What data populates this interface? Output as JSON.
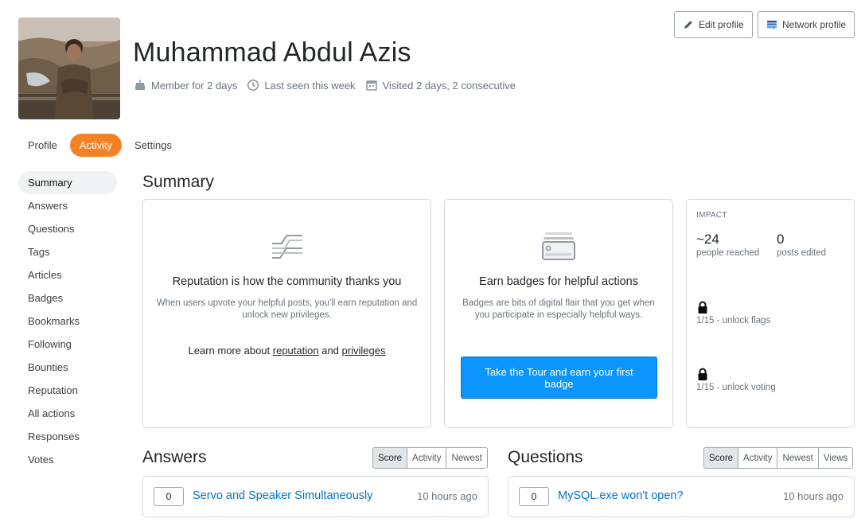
{
  "profile": {
    "name": "Muhammad Abdul Azis",
    "member_for": "Member for 2 days",
    "last_seen": "Last seen this week",
    "visited": "Visited 2 days, 2 consecutive"
  },
  "header_buttons": {
    "edit": "Edit profile",
    "network": "Network profile"
  },
  "tabs": [
    {
      "label": "Profile",
      "active": false
    },
    {
      "label": "Activity",
      "active": true
    },
    {
      "label": "Settings",
      "active": false
    }
  ],
  "sidenav": [
    {
      "label": "Summary",
      "active": true
    },
    {
      "label": "Answers"
    },
    {
      "label": "Questions"
    },
    {
      "label": "Tags"
    },
    {
      "label": "Articles"
    },
    {
      "label": "Badges"
    },
    {
      "label": "Bookmarks"
    },
    {
      "label": "Following"
    },
    {
      "label": "Bounties"
    },
    {
      "label": "Reputation"
    },
    {
      "label": "All actions"
    },
    {
      "label": "Responses"
    },
    {
      "label": "Votes"
    }
  ],
  "summary": {
    "title": "Summary",
    "reputation": {
      "heading": "Reputation is how the community thanks you",
      "desc": "When users upvote your helpful posts, you'll earn reputation and unlock new privileges.",
      "learn_prefix": "Learn more about",
      "link_reputation": "reputation",
      "learn_and": "and",
      "link_privileges": "privileges"
    },
    "badges": {
      "heading": "Earn badges for helpful actions",
      "desc": "Badges are bits of digital flair that you get when you participate in especially helpful ways.",
      "tour_button": "Take the Tour and earn your first badge"
    },
    "impact": {
      "label": "IMPACT",
      "people_reached": "~24",
      "people_reached_label": "people reached",
      "posts_edited": "0",
      "posts_edited_label": "posts edited",
      "flags": "1/15 - unlock flags",
      "voting": "1/15 - unlock voting"
    }
  },
  "answers": {
    "title": "Answers",
    "sort_options": [
      "Score",
      "Activity",
      "Newest"
    ],
    "selected": "Score",
    "items": [
      {
        "votes": "0",
        "title": "Servo and Speaker Simultaneously",
        "time": "10 hours ago"
      }
    ]
  },
  "questions": {
    "title": "Questions",
    "sort_options": [
      "Score",
      "Activity",
      "Newest",
      "Views"
    ],
    "selected": "Score",
    "items": [
      {
        "votes": "0",
        "title": "MySQL.exe won't open?",
        "time": "10 hours ago"
      }
    ]
  },
  "colors": {
    "accent_orange": "#f48225",
    "primary_blue": "#0a95ff",
    "link_blue": "#0074cc"
  }
}
